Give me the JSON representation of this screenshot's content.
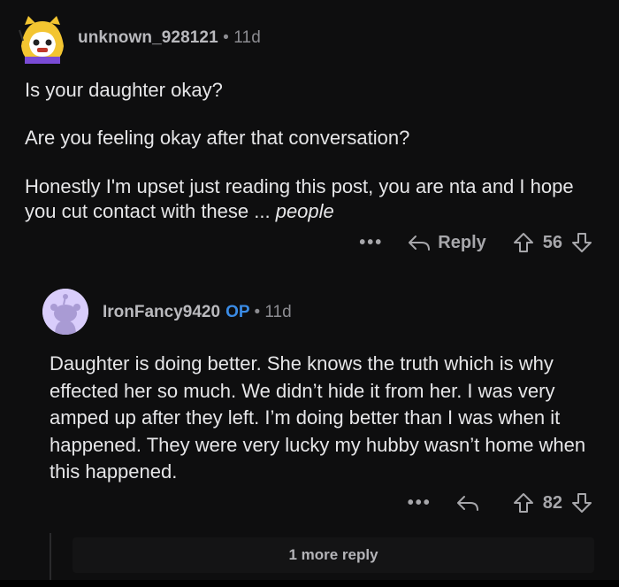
{
  "comment": {
    "username": "unknown_928121",
    "age": "• 11d",
    "paragraphs": [
      "Is your daughter okay?",
      "Are you feeling okay after that conversation?"
    ],
    "para3_text": "Honestly I'm upset just reading this post, you are nta and I hope you cut contact with these ... ",
    "para3_italic": "people",
    "more_icon": "•••",
    "reply_label": "Reply",
    "vote_count": "56",
    "icons": [
      "reply-arrow-icon",
      "upvote-icon",
      "downvote-icon",
      "more-options-icon"
    ]
  },
  "reply": {
    "username": "IronFancy9420",
    "op_badge": "OP",
    "age": "• 11d",
    "text": "Daughter is doing better. She knows the truth which is why effected her so much. We didn’t hide it from her. I was very amped up after they left. I’m doing better than I was when it happened. They were very lucky my hubby wasn’t home when this happened.",
    "more_icon": "•••",
    "vote_count": "82"
  },
  "more_replies_label": "1 more reply",
  "colors": {
    "background": "#0e0e0f",
    "op_accent": "#3b8ce6",
    "avatar2_bg": "#d9cdfb",
    "avatar1_bg": "#f3c531"
  }
}
